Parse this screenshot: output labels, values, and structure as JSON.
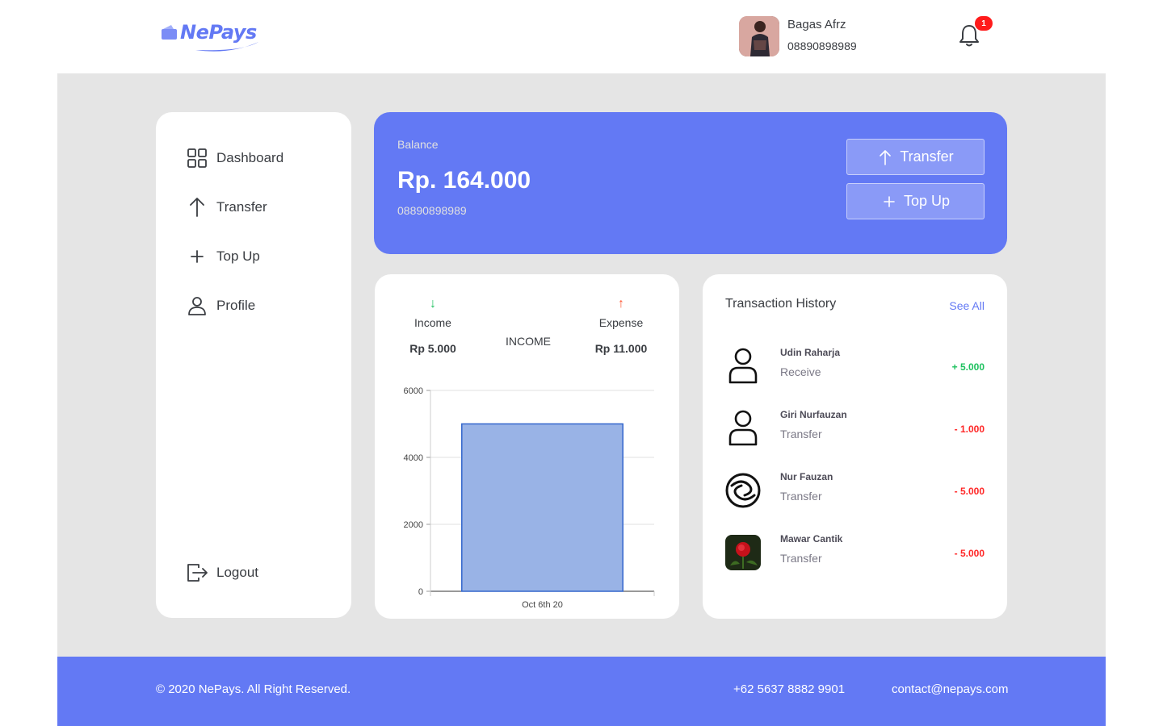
{
  "header": {
    "logo_text": "NePays",
    "user_name": "Bagas Afrz",
    "user_phone": "08890898989",
    "notification_count": "1"
  },
  "sidebar": {
    "items": [
      {
        "label": "Dashboard",
        "icon": "grid-icon"
      },
      {
        "label": "Transfer",
        "icon": "arrow-up-icon"
      },
      {
        "label": "Top Up",
        "icon": "plus-icon"
      },
      {
        "label": "Profile",
        "icon": "user-icon"
      }
    ],
    "logout_label": "Logout"
  },
  "balance": {
    "label": "Balance",
    "value": "Rp. 164.000",
    "phone": "08890898989",
    "transfer_label": "Transfer",
    "topup_label": "Top Up",
    "color": "#6379f4"
  },
  "summary": {
    "income_label": "Income",
    "income_amount": "Rp 5.000",
    "expense_label": "Expense",
    "expense_amount": "Rp 11.000",
    "center_label": "INCOME",
    "income_arrow": "↓",
    "expense_arrow": "↑"
  },
  "chart_data": {
    "type": "bar",
    "categories": [
      "Oct 6th 20"
    ],
    "values": [
      5000
    ],
    "title": "INCOME",
    "ylim": [
      0,
      6000
    ],
    "yticks": [
      0,
      2000,
      4000,
      6000
    ],
    "grid": true,
    "bar_color": "#99b3e6",
    "bar_border": "#3366cc"
  },
  "transactions": {
    "title": "Transaction History",
    "see_all": "See All",
    "items": [
      {
        "name": "Udin Raharja",
        "type": "Receive",
        "amount": "+ 5.000",
        "icon": "user-outline-icon",
        "sign": "pos"
      },
      {
        "name": "Giri Nurfauzan",
        "type": "Transfer",
        "amount": "- 1.000",
        "icon": "user-outline-icon",
        "sign": "neg"
      },
      {
        "name": "Nur Fauzan",
        "type": "Transfer",
        "amount": "- 5.000",
        "icon": "swirl-logo-icon",
        "sign": "neg"
      },
      {
        "name": "Mawar Cantik",
        "type": "Transfer",
        "amount": "- 5.000",
        "icon": "rose-photo-icon",
        "sign": "neg"
      }
    ]
  },
  "footer": {
    "copyright": "© 2020 NePays. All Right Reserved.",
    "phone": "+62 5637 8882 9901",
    "email": "contact@nepays.com"
  }
}
